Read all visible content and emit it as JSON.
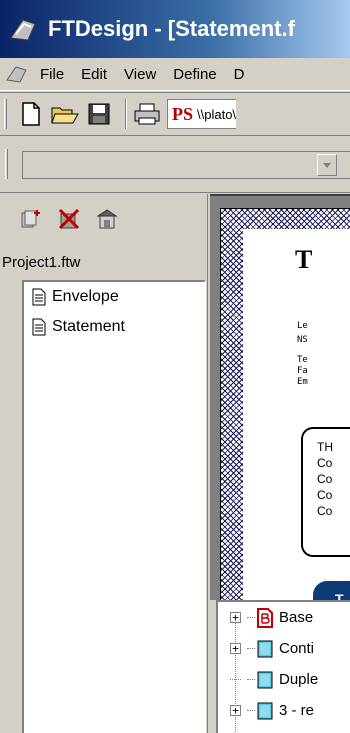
{
  "window": {
    "title": "FTDesign - [Statement.f",
    "app_icon": "ftdesign-icon"
  },
  "menu": {
    "items": [
      {
        "label": "File"
      },
      {
        "label": "Edit"
      },
      {
        "label": "View"
      },
      {
        "label": "Define"
      },
      {
        "label": "D"
      }
    ]
  },
  "toolbar": {
    "buttons": [
      "new-file-icon",
      "open-folder-icon",
      "save-disk-icon",
      "print-icon"
    ],
    "path_logo": "PS",
    "path_value": "\\\\plato\\"
  },
  "project": {
    "filename": "Project1.ftw",
    "tools": [
      "add-form-icon",
      "delete-icon",
      "properties-icon"
    ],
    "items": [
      {
        "label": "Envelope"
      },
      {
        "label": "Statement"
      }
    ]
  },
  "preview": {
    "heading": "T",
    "address_lines": [
      "Le",
      "NS"
    ],
    "contact_lines": [
      "Te",
      "Fa",
      "Em"
    ],
    "box_lines": [
      "TH",
      "Co",
      "Co",
      "Co",
      "Co"
    ],
    "tab_label": "T",
    "colors": {
      "tab": "#0b3a75",
      "border_pattern": "#1a1a5a"
    }
  },
  "layers": {
    "items": [
      {
        "label": "Base",
        "icon": "base-page-icon",
        "expandable": true
      },
      {
        "label": "Conti",
        "icon": "page-layer-icon",
        "expandable": true
      },
      {
        "label": "Duple",
        "icon": "page-layer-icon",
        "expandable": false
      },
      {
        "label": "3 - re",
        "icon": "page-layer-icon",
        "expandable": true
      }
    ]
  }
}
